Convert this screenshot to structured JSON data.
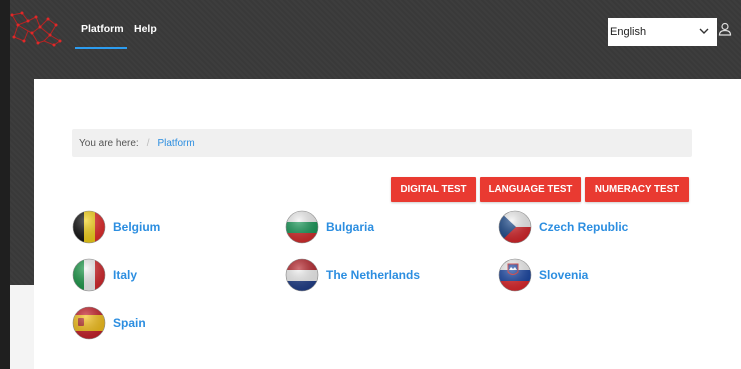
{
  "nav": {
    "items": [
      "Platform",
      "Help"
    ]
  },
  "language": {
    "selected": "English"
  },
  "breadcrumb": {
    "prefix": "You are here:",
    "separator": "/",
    "current": "Platform"
  },
  "tests": [
    "DIGITAL TEST",
    "LANGUAGE TEST",
    "NUMERACY TEST"
  ],
  "countries": [
    {
      "name": "Belgium",
      "flag": "belgium-flag-icon"
    },
    {
      "name": "Bulgaria",
      "flag": "bulgaria-flag-icon"
    },
    {
      "name": "Czech Republic",
      "flag": "czech-flag-icon"
    },
    {
      "name": "Italy",
      "flag": "italy-flag-icon"
    },
    {
      "name": "The Netherlands",
      "flag": "netherlands-flag-icon"
    },
    {
      "name": "Slovenia",
      "flag": "slovenia-flag-icon"
    },
    {
      "name": "Spain",
      "flag": "spain-flag-icon"
    }
  ],
  "colors": {
    "accent": "#e93a31",
    "link": "#2c8ee0",
    "nav_underline": "#2c9cf0"
  }
}
